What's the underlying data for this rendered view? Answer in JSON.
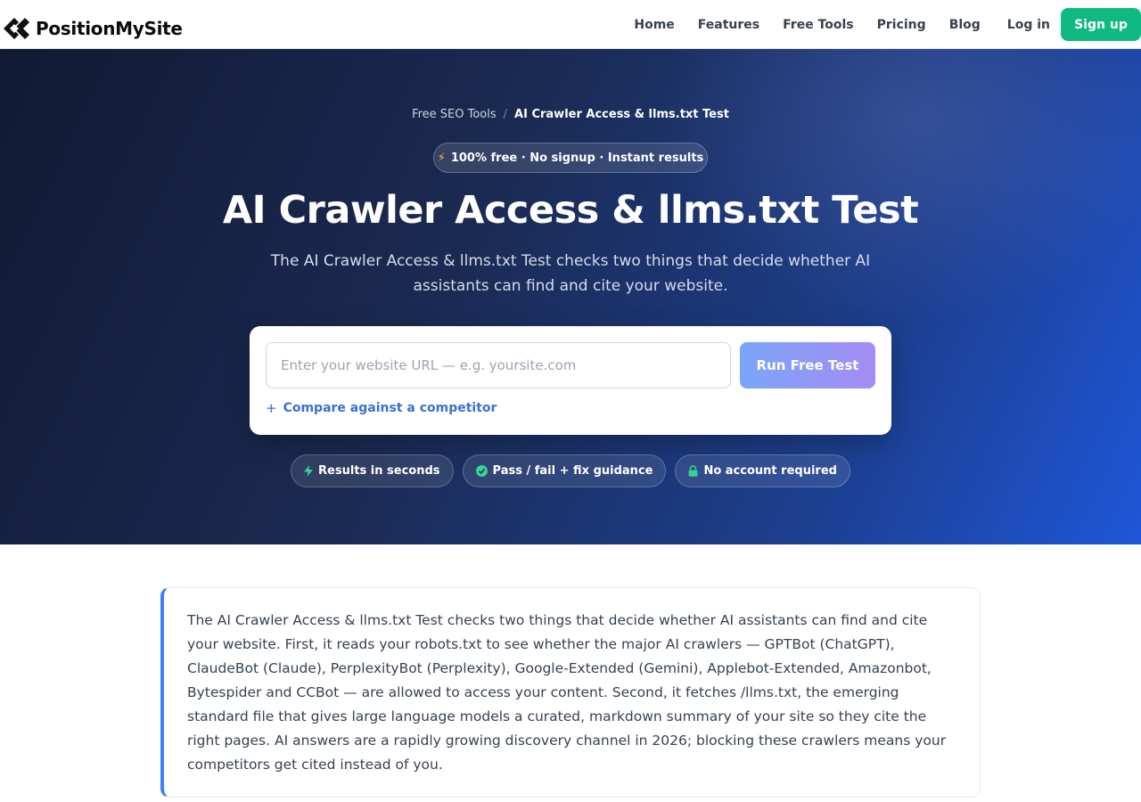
{
  "header": {
    "logo_text": "PositionMySite",
    "nav": [
      "Home",
      "Features",
      "Free Tools",
      "Pricing",
      "Blog"
    ],
    "login_label": "Log in",
    "signup_label": "Sign up"
  },
  "breadcrumb": {
    "parent": "Free SEO Tools",
    "separator": "/",
    "current": "AI Crawler Access & llms.txt Test"
  },
  "hero": {
    "pill_text": "100% free · No signup · Instant results",
    "title": "AI Crawler Access & llms.txt Test",
    "subtitle": "The AI Crawler Access & llms.txt Test checks two things that decide whether AI assistants can find and cite your website."
  },
  "form": {
    "url_placeholder": "Enter your website URL — e.g. yoursite.com",
    "run_label": "Run Free Test",
    "compare_label": "Compare against a competitor"
  },
  "features": [
    {
      "icon": "bolt-icon",
      "label": "Results in seconds"
    },
    {
      "icon": "check-circle-icon",
      "label": "Pass / fail + fix guidance"
    },
    {
      "icon": "lock-icon",
      "label": "No account required"
    }
  ],
  "info": {
    "text": "The AI Crawler Access & llms.txt Test checks two things that decide whether AI assistants can find and cite your website. First, it reads your robots.txt to see whether the major AI crawlers — GPTBot (ChatGPT), ClaudeBot (Claude), PerplexityBot (Perplexity), Google-Extended (Gemini), Applebot-Extended, Amazonbot, Bytespider and CCBot — are allowed to access your content. Second, it fetches /llms.txt, the emerging standard file that gives large language models a curated, markdown summary of your site so they cite the right pages. AI answers are a rapidly growing discovery channel in 2026; blocking these crawlers means your competitors get cited instead of you."
  },
  "colors": {
    "accent_green": "#10b981",
    "link_blue": "#3b6fd4",
    "border_blue": "#3b82f6"
  }
}
